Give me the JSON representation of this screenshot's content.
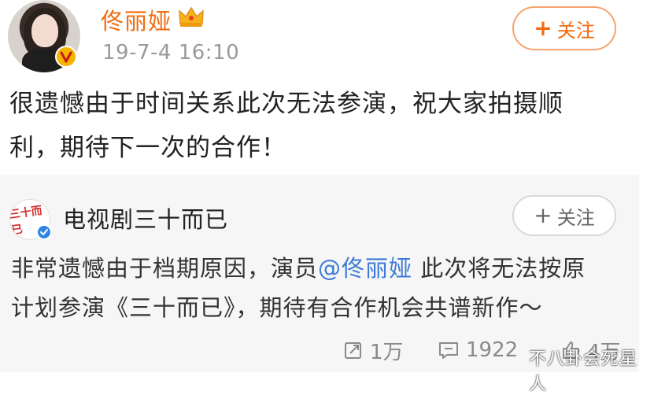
{
  "post": {
    "username": "佟丽娅",
    "timestamp": "19-7-4 16:10",
    "follow_label": "关注",
    "text_line1": "很遗憾由于时间关系此次无法参演，祝大家拍摄顺",
    "text_line2": "利，期待下一次的合作！"
  },
  "repost": {
    "account_name": "电视剧三十而已",
    "avatar_logo": "三十而已",
    "follow_label": "关注",
    "text_line1_before": "非常遗憾由于档期原因，演员",
    "mention": "@佟丽娅",
    "text_line1_after": " 此次将无法按原",
    "text_line2": "计划参演《三十而已》，期待有合作机会共谱新作～",
    "stats": {
      "reposts": "1万",
      "comments": "1922",
      "likes": "4万"
    }
  },
  "watermark": "不八卦会死星人",
  "colors": {
    "username": "#f26b0e",
    "mention": "#3d7bd6",
    "card_bg": "#f6f6f6"
  }
}
